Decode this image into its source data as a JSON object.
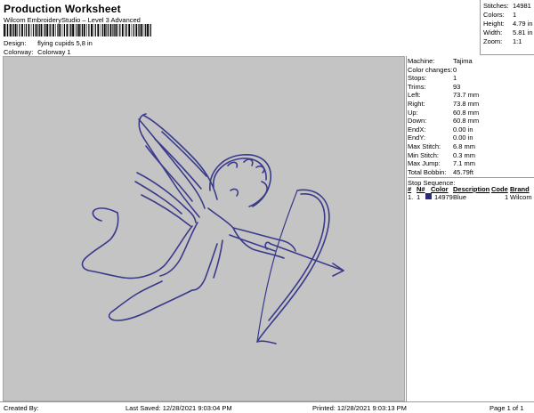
{
  "header": {
    "title": "Production Worksheet",
    "subtitle": "Wilcom EmbroideryStudio – Level 3 Advanced",
    "design_label": "Design:",
    "design_value": "flying cupids 5,8 in",
    "colorway_label": "Colorway:",
    "colorway_value": "Colorway 1"
  },
  "summary": {
    "stitches_label": "Stitches:",
    "stitches_value": "14981",
    "colors_label": "Colors:",
    "colors_value": "1",
    "height_label": "Height:",
    "height_value": "4.79 in",
    "width_label": "Width:",
    "width_value": "5.81 in",
    "zoom_label": "Zoom:",
    "zoom_value": "1:1"
  },
  "details": [
    {
      "label": "Machine:",
      "value": "Tajima"
    },
    {
      "label": "Color changes:",
      "value": "0"
    },
    {
      "label": "Stops:",
      "value": "1"
    },
    {
      "label": "Trims:",
      "value": "93"
    },
    {
      "label": "Left:",
      "value": "73.7 mm"
    },
    {
      "label": "Right:",
      "value": "73.8 mm"
    },
    {
      "label": "Up:",
      "value": "60.8 mm"
    },
    {
      "label": "Down:",
      "value": "60.8 mm"
    },
    {
      "label": "EndX:",
      "value": "0.00 in"
    },
    {
      "label": "EndY:",
      "value": "0.00 in"
    },
    {
      "label": "Max Stitch:",
      "value": "6.8 mm"
    },
    {
      "label": "Min Stitch:",
      "value": "0.3 mm"
    },
    {
      "label": "Max Jump:",
      "value": "7.1 mm"
    },
    {
      "label": "Total Bobbin:",
      "value": "45.79ft"
    }
  ],
  "sequence": {
    "title": "Stop Sequence:",
    "headers": {
      "num": "#",
      "n": "N#",
      "color": "Color",
      "description": "Description",
      "code": "Code",
      "brand": "Brand"
    },
    "rows": [
      {
        "num": "1.",
        "n": "1",
        "color": "14979",
        "description": "Blue",
        "code": "1",
        "brand": "Wilcom",
        "swatch": "#2e2a7a"
      }
    ]
  },
  "footer": {
    "created": "Created By:",
    "saved": "Last Saved: 12/28/2021 9:03:04 PM",
    "printed": "Printed: 12/28/2021 9:03:13 PM",
    "page": "Page 1 of 1"
  },
  "colors": {
    "thread": "#3a3a8c",
    "preview_bg": "#c4c4c4"
  }
}
